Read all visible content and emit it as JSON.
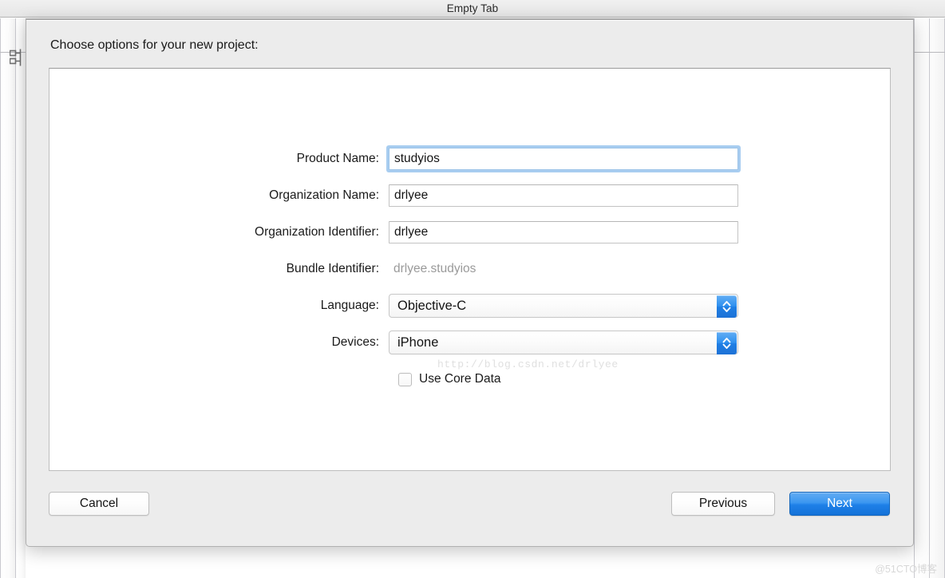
{
  "window": {
    "title": "Empty Tab",
    "toolbar_icon": "outline-view-icon"
  },
  "sheet": {
    "heading": "Choose options for your new project:",
    "fields": [
      {
        "label": "Product Name:",
        "value": "studyios",
        "type": "text",
        "focused": true,
        "name": "product-name"
      },
      {
        "label": "Organization Name:",
        "value": "drlyee",
        "type": "text",
        "focused": false,
        "name": "organization-name"
      },
      {
        "label": "Organization Identifier:",
        "value": "drlyee",
        "type": "text",
        "focused": false,
        "name": "organization-identifier"
      },
      {
        "label": "Bundle Identifier:",
        "value": "drlyee.studyios",
        "type": "static",
        "focused": false,
        "name": "bundle-identifier"
      },
      {
        "label": "Language:",
        "value": "Objective-C",
        "type": "popup",
        "focused": false,
        "name": "language"
      },
      {
        "label": "Devices:",
        "value": "iPhone",
        "type": "popup",
        "focused": false,
        "name": "devices"
      }
    ],
    "checkbox": {
      "label": "Use Core Data",
      "checked": false
    },
    "buttons": {
      "cancel": "Cancel",
      "previous": "Previous",
      "next": "Next"
    }
  },
  "watermarks": {
    "url": "http://blog.csdn.net/drlyee",
    "corner": "@51CTO博客"
  },
  "colors": {
    "accent_blue": "#1e80e8",
    "focus_ring": "#a8cdf0",
    "sheet_bg": "#ececec",
    "muted_text": "#9a9a9a"
  }
}
